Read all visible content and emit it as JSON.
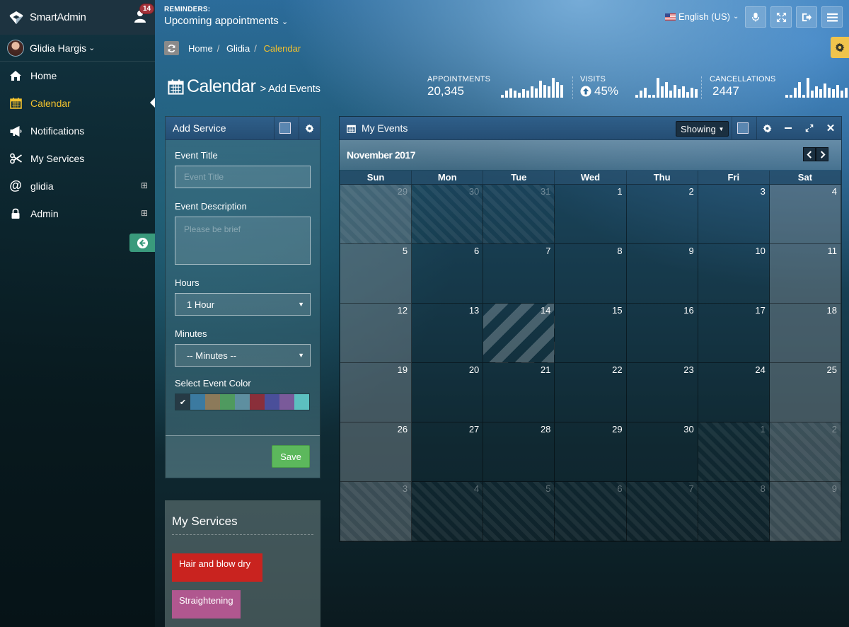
{
  "header": {
    "brand": "SmartAdmin",
    "notification_count": "14",
    "reminders_label": "REMINDERS:",
    "reminders_value": "Upcoming appointments",
    "language": "English (US)"
  },
  "sidebar": {
    "user_name": "Glidia Hargis",
    "items": [
      {
        "label": "Home",
        "icon": "home-icon"
      },
      {
        "label": "Calendar",
        "icon": "calendar-icon",
        "active": true
      },
      {
        "label": "Notifications",
        "icon": "bullhorn-icon"
      },
      {
        "label": "My Services",
        "icon": "scissors-icon"
      },
      {
        "label": "glidia",
        "icon": "at-icon"
      },
      {
        "label": "Admin",
        "icon": "lock-icon"
      }
    ]
  },
  "breadcrumb": [
    "Home",
    "Glidia",
    "Calendar"
  ],
  "page": {
    "title": "Calendar",
    "subtitle": "> Add Events"
  },
  "stats": {
    "appointments": {
      "label": "APPOINTMENTS",
      "value": "20,345"
    },
    "visits": {
      "label": "VISITS",
      "value": "45%"
    },
    "cancellations": {
      "label": "CANCELLATIONS",
      "value": "2447"
    }
  },
  "add_service": {
    "title": "Add Service",
    "event_title_label": "Event Title",
    "event_title_placeholder": "Event Title",
    "event_description_label": "Event Description",
    "event_description_placeholder": "Please be brief",
    "hours_label": "Hours",
    "hours_value": "1 Hour",
    "minutes_label": "Minutes",
    "minutes_value": "-- Minutes --",
    "color_label": "Select Event Color",
    "colors": [
      "#263a45",
      "#3b7aa0",
      "#8c7a5a",
      "#4f9a5f",
      "#5e8fa0",
      "#8a2f3a",
      "#4a4f9a",
      "#7a5a9a",
      "#5cc0c0"
    ],
    "save_label": "Save"
  },
  "my_services": {
    "title": "My Services",
    "items": [
      {
        "label": "Hair and blow dry",
        "color": "#c9231f"
      },
      {
        "label": "Straightening",
        "color": "#b0578f"
      }
    ]
  },
  "calendar": {
    "widget_title": "My Events",
    "showing_label": "Showing",
    "month": "November 2017",
    "weekdays": [
      "Sun",
      "Mon",
      "Tue",
      "Wed",
      "Thu",
      "Fri",
      "Sat"
    ],
    "weeks": [
      [
        "29",
        "30",
        "31",
        "1",
        "2",
        "3",
        "4"
      ],
      [
        "5",
        "6",
        "7",
        "8",
        "9",
        "10",
        "11"
      ],
      [
        "12",
        "13",
        "14",
        "15",
        "16",
        "17",
        "18"
      ],
      [
        "19",
        "20",
        "21",
        "22",
        "23",
        "24",
        "25"
      ],
      [
        "26",
        "27",
        "28",
        "29",
        "30",
        "1",
        "2"
      ],
      [
        "3",
        "4",
        "5",
        "6",
        "7",
        "8",
        "9"
      ]
    ],
    "today": "14"
  }
}
